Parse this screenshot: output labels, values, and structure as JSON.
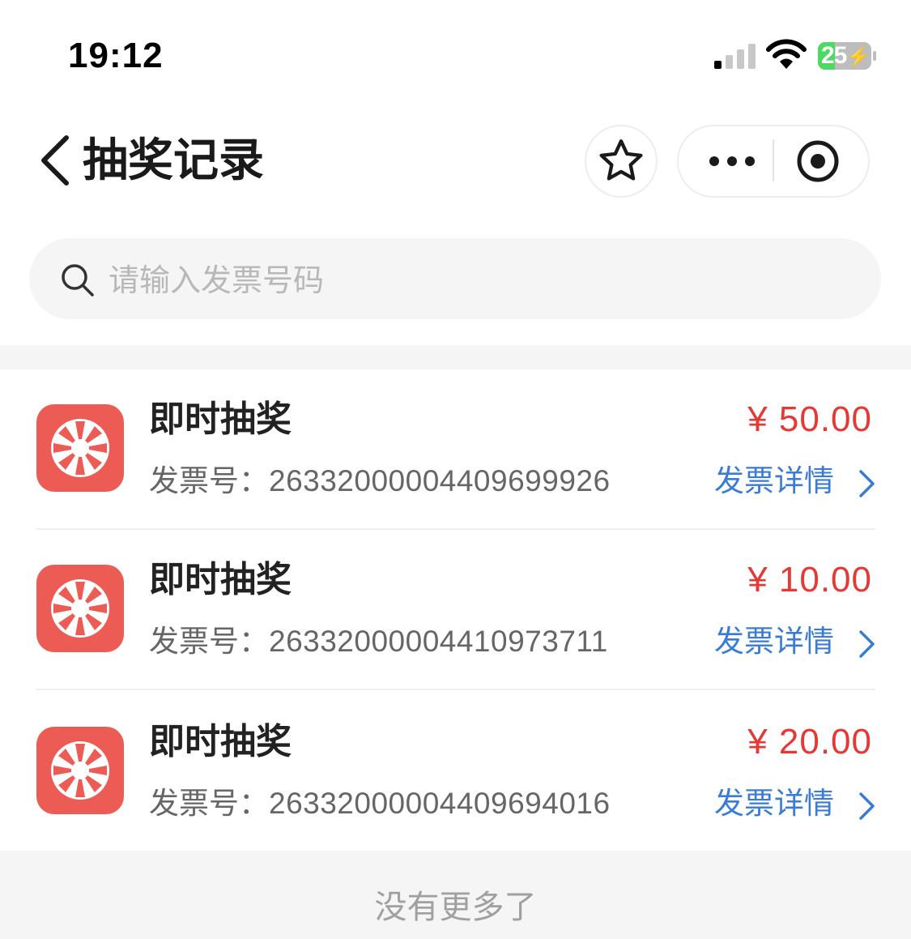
{
  "status_bar": {
    "time": "19:12",
    "battery": "25"
  },
  "nav": {
    "title": "抽奖记录",
    "icons": [
      "back-chevron-icon",
      "star-icon",
      "more-dots-icon",
      "target-close-icon"
    ]
  },
  "search": {
    "placeholder": "请输入发票号码",
    "value": ""
  },
  "records": [
    {
      "title": "即时抽奖",
      "amount": "¥ 50.00",
      "invoice_label": "发票号：",
      "invoice_number": "26332000004409699926",
      "detail_label": "发票详情"
    },
    {
      "title": "即时抽奖",
      "amount": "¥ 10.00",
      "invoice_label": "发票号：",
      "invoice_number": "26332000004410973711",
      "detail_label": "发票详情"
    },
    {
      "title": "即时抽奖",
      "amount": "¥ 20.00",
      "invoice_label": "发票号：",
      "invoice_number": "26332000004409694016",
      "detail_label": "发票详情"
    }
  ],
  "footer": {
    "text": "没有更多了"
  },
  "colors": {
    "accent_red": "#e53935",
    "icon_bg": "#ec5b54",
    "link_blue": "#3a7bd5",
    "battery_green": "#4cd964"
  }
}
